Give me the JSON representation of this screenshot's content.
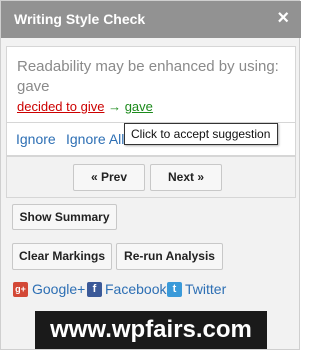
{
  "window": {
    "title": "Writing Style Check",
    "close_symbol": "×"
  },
  "suggestion": {
    "message": "Readability may be enhanced by using: gave",
    "original": "decided to give",
    "arrow": "→",
    "replacement": "gave"
  },
  "actions": {
    "ignore": "Ignore",
    "ignore_all": "Ignore All",
    "tooltip": "Click to accept suggestion"
  },
  "nav": {
    "prev": "« Prev",
    "next": "Next »"
  },
  "buttons": {
    "show_summary": "Show Summary",
    "clear_markings": "Clear Markings",
    "rerun_analysis": "Re-run Analysis"
  },
  "share": {
    "google": "Google+",
    "facebook": "Facebook",
    "twitter": "Twitter",
    "google_icon": "googleplus-icon",
    "facebook_icon": "facebook-icon",
    "twitter_icon": "twitter-icon"
  },
  "watermark": "www.wpfairs.com",
  "colors": {
    "titlebar": "#929292",
    "link": "#2d6fb4",
    "error": "#cc0000",
    "accept": "#1b8a1b"
  }
}
